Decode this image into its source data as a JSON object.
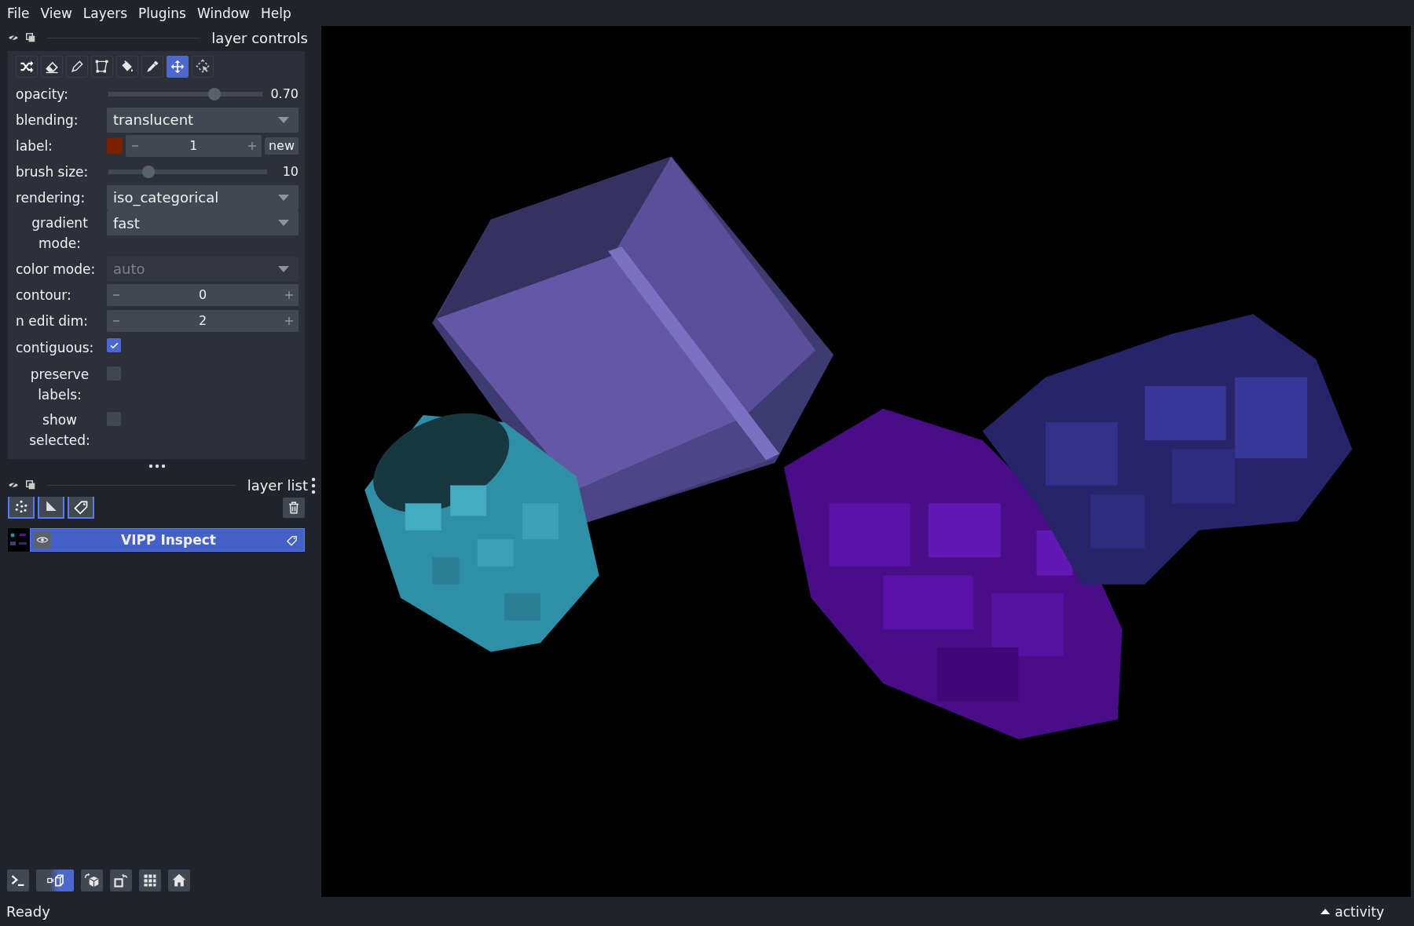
{
  "menu": [
    "File",
    "View",
    "Layers",
    "Plugins",
    "Window",
    "Help"
  ],
  "layer_controls": {
    "title": "layer controls",
    "tools": [
      {
        "kind": "shuffle",
        "selected": false
      },
      {
        "kind": "eraser",
        "selected": false
      },
      {
        "kind": "pencil",
        "selected": false
      },
      {
        "kind": "polygon",
        "selected": false
      },
      {
        "kind": "bucket",
        "selected": false
      },
      {
        "kind": "dropper",
        "selected": false
      },
      {
        "kind": "move",
        "selected": true
      },
      {
        "kind": "select",
        "selected": false
      }
    ],
    "rows": [
      {
        "kind": "slider",
        "label": "opacity:",
        "level": 0.69,
        "reading": "0.70"
      },
      {
        "kind": "dropdown",
        "label": "blending:",
        "value": "translucent",
        "disabled": false
      },
      {
        "kind": "label",
        "label": "label:",
        "color": "#7a1f00",
        "value": "1",
        "button": "new"
      },
      {
        "kind": "slider",
        "label": "brush size:",
        "level": 0.25,
        "reading": "10"
      },
      {
        "kind": "dropdown",
        "label": "rendering:",
        "value": "iso_categorical",
        "disabled": false
      },
      {
        "kind": "dropdown",
        "label": "gradient mode:",
        "value": "fast",
        "disabled": false
      },
      {
        "kind": "dropdown",
        "label": "color mode:",
        "value": "auto",
        "disabled": true
      },
      {
        "kind": "spinbox",
        "label": "contour:",
        "value": "0"
      },
      {
        "kind": "spinbox",
        "label": "n edit dim:",
        "value": "2"
      },
      {
        "kind": "checkbox",
        "label": "contiguous:",
        "checked": true
      },
      {
        "kind": "checkbox",
        "label": "preserve labels:",
        "checked": false
      },
      {
        "kind": "checkbox",
        "label": "show selected:",
        "checked": false
      }
    ]
  },
  "layer_list": {
    "title": "layer list",
    "buttons": [
      {
        "kind": "points"
      },
      {
        "kind": "shapes"
      },
      {
        "kind": "labels"
      }
    ],
    "layers": [
      {
        "name": "VIPP Inspect",
        "selected": true,
        "visible": true
      }
    ]
  },
  "viewer_buttons": [
    {
      "kind": "console",
      "on": false
    },
    {
      "kind": "ndisplay",
      "on": true
    },
    {
      "kind": "roll",
      "on": false
    },
    {
      "kind": "transpose",
      "on": false
    },
    {
      "kind": "grid",
      "on": false
    },
    {
      "kind": "home",
      "on": false
    }
  ],
  "status_bar": {
    "message": "Ready",
    "activity": "activity"
  }
}
